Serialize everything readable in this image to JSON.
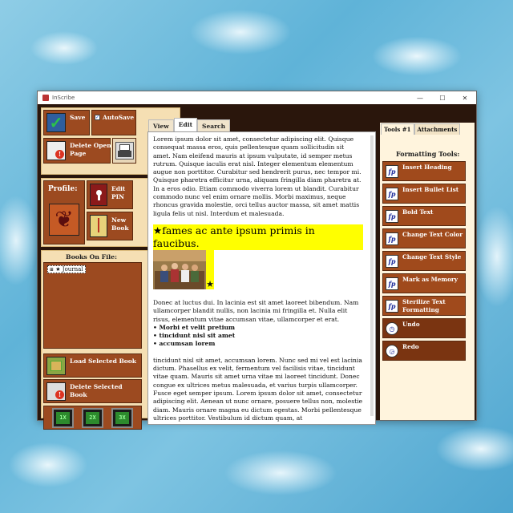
{
  "window": {
    "title": "InScribe"
  },
  "left": {
    "save": "Save",
    "autosave": "AutoSave",
    "delete_open_page": "Delete Open Page",
    "profile": "Profile:",
    "edit_pin": "Edit PIN",
    "new_book": "New Book",
    "books_on_file": "Books On File:",
    "journal": "Journal",
    "load_selected_book": "Load Selected Book",
    "delete_selected_book": "Delete Selected Book",
    "speeds": [
      "1X",
      "2X",
      "3X"
    ]
  },
  "tabs": [
    "View",
    "Edit",
    "Search"
  ],
  "editor": {
    "para1": "Lorem ipsum dolor sit amet, consectetur adipiscing elit. Quisque consequat massa eros, quis pellentesque quam sollicitudin sit amet. Nam eleifend mauris at ipsum vulputate, id semper metus rutrum. Quisque iaculis erat nisl. Integer elementum elementum augue non porttitor. Curabitur sed hendrerit purus, nec tempor mi. Quisque pharetra efficitur urna, aliquam fringilla diam pharetra at. In a eros odio. Etiam commodo viverra lorem ut blandit. Curabitur commodo nunc vel enim ornare mollis. Morbi maximus, neque rhoncus gravida molestie, orci tellus auctor massa, sit amet mattis ligula felis ut nisl. Interdum et malesuada.",
    "heading": "★fames ac ante ipsum primis in faucibus.",
    "star": "★",
    "para2": "Donec at luctus dui. In lacinia est sit amet laoreet bibendum. Nam ullamcorper blandit nullis, non lacinia mi fringilla et. Nulla elit risus, elementum vitae accumsan vitae, ullamcorper et erat.",
    "bullets": [
      "• Morbi et velit pretium",
      "• tincidunt nisl sit amet",
      "• accumsan lorem"
    ],
    "para3": "tincidunt nisl sit amet, accumsan lorem. Nunc sed mi vel est lacinia dictum. Phasellus ex velit, fermentum vel facilisis vitae, tincidunt vitae quam. Mauris sit amet urna vitae mi laoreet tincidunt. Donec congue ex ultrices metus malesuada, et varius turpis ullamcorper. Fusce eget semper ipsum. Lorem ipsum dolor sit amet, consectetur adipiscing elit. Aenean ut nunc ornare, posuere tellus non, molestie diam. Mauris ornare magna eu dictum egestas. Morbi pellentesque ultrices porttitor. Vestibulum id dictum quam, at"
  },
  "right": {
    "tabs": [
      "Tools #1",
      "Attachments"
    ],
    "title": "Formatting Tools:",
    "buttons": [
      "Insert Heading",
      "Insert Bullet List",
      "Bold Text",
      "Change Text Color",
      "Change Text Style",
      "Mark as Memory",
      "Sterilize Text Formatting",
      "Undo",
      "Redo"
    ]
  }
}
